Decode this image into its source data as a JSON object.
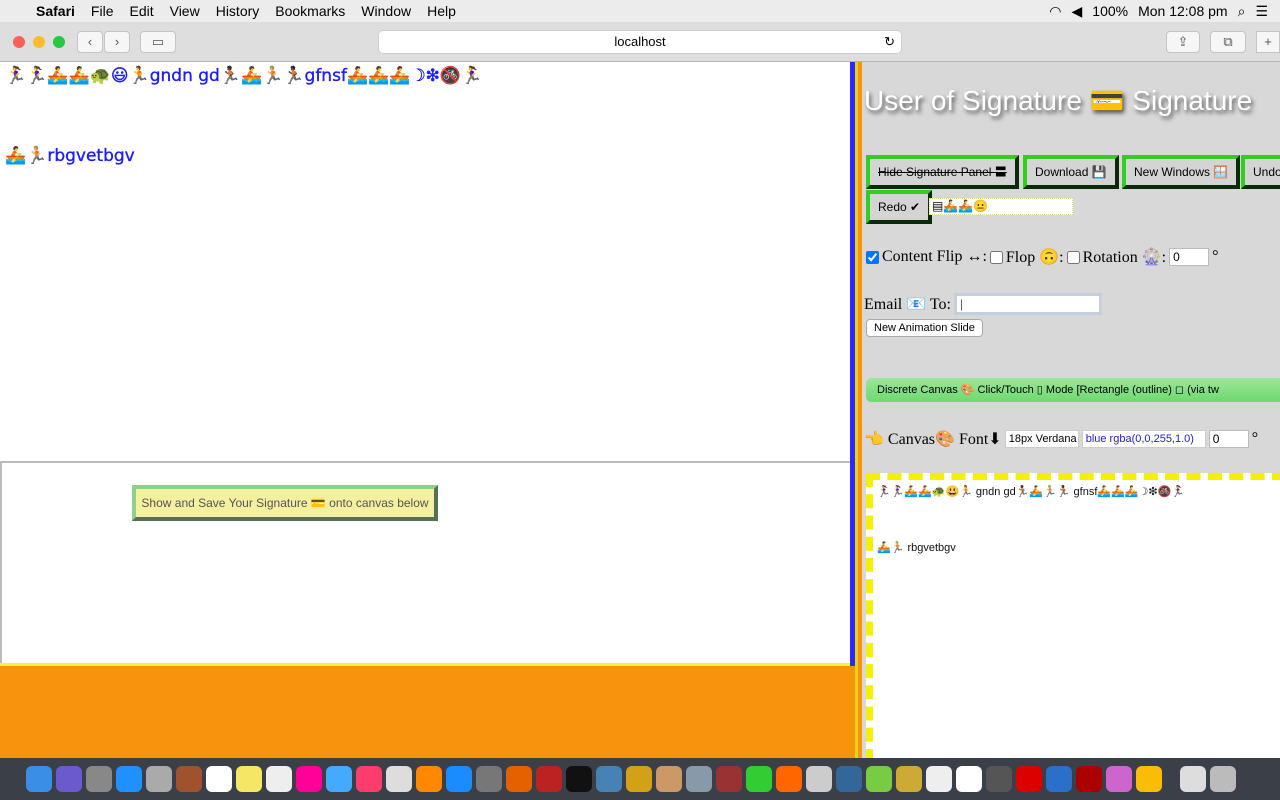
{
  "menubar": {
    "apple": "",
    "app": "Safari",
    "items": [
      "File",
      "Edit",
      "View",
      "History",
      "Bookmarks",
      "Window",
      "Help"
    ],
    "battery": "100%",
    "clock": "Mon 12:08 pm"
  },
  "browser": {
    "url": "localhost"
  },
  "left": {
    "line1_pre": "🏃‍♀️🏃‍♀️🚣🚣🐢😃🏃",
    "line1_a": "gndn gd",
    "line1_mid": "🏃🏿🚣🏃🏼🏃🏿",
    "line1_b": "gfnsf",
    "line1_post": "🚣🚣🚣☽❇🚳🏃‍♀️",
    "line2_pre": "🚣🏃🏼",
    "line2_text": "rbgvetbgv",
    "show_button": "Show and Save Your Signature 💳 onto canvas below"
  },
  "right": {
    "title": "User of Signature 💳 Signature",
    "buttons": {
      "hide": "Hide Signature Panel 〓",
      "download": "Download 💾",
      "new_windows": "New Windows 🪟",
      "undo": "Undo",
      "redo": "Redo ✔"
    },
    "emoji_field": "▤🚣🚣😐",
    "flip_label": "Content Flip ↔:",
    "flop_label": "Flop 🙃:",
    "rotation_label": "Rotation 🎡:",
    "rotation_value": "0",
    "degree": "°",
    "email_label": "Email 📧 To:",
    "email_value": "|",
    "anim_button": "New Animation Slide",
    "mode_select": "Discrete Canvas 🎨 Click/Touch ▯ Mode [Rectangle (outline) ◻ (via tw",
    "font_label": "👈 Canvas🎨 Font⬇",
    "font_value": "18px Verdana",
    "color_value": "blue rgba(0,0,255,1.0)",
    "font_rot": "0",
    "canvas_line1": "🏃‍♀️🏃‍♀️🚣🚣🐢😃🏃 gndn gd🏃🏿🚣🏃🏼🏃🏿 gfnsf🚣🚣🚣☽❇🚳🏃‍♀️",
    "canvas_line2": "🚣🏃🏼 rbgvetbgv"
  }
}
